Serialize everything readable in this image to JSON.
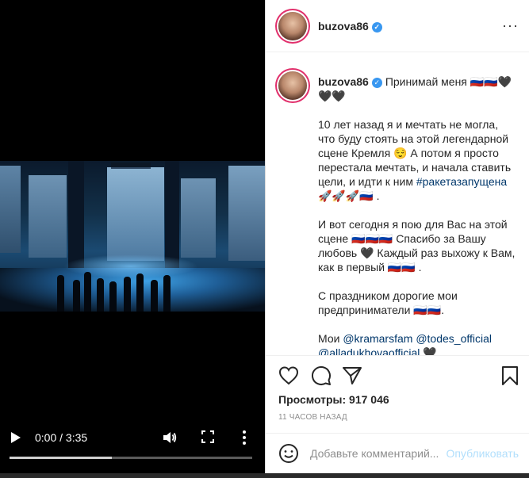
{
  "video": {
    "time": "0:00 / 3:35",
    "progress_fraction": 0.42,
    "icons": {
      "play": "play-icon",
      "volume": "volume-icon",
      "fullscreen": "fullscreen-icon",
      "more": "more-vertical-icon"
    }
  },
  "header": {
    "username": "buzova86",
    "more_label": "···"
  },
  "caption": {
    "username": "buzova86",
    "line1": "Принимай меня 🇷🇺🇷🇺🖤🖤🖤",
    "para1_a": "10 лет назад я и мечтать не могла, что буду стоять на этой легендарной сцене Кремля 😌 А потом я просто перестала мечтать, и начала ставить цели, и идти к ним ",
    "para1_tag": "#ракетазапущена",
    "para1_b": " 🚀🚀🚀🇷🇺 .",
    "para2": "И вот сегодня я пою для Вас на этой сцене 🇷🇺🇷🇺🇷🇺 Спасибо за Вашу любовь 🖤 Каждый раз выхожу к Вам, как в первый 🇷🇺🇷🇺 .",
    "para3": "С праздником дорогие мои предприниматели 🇷🇺🇷🇺.",
    "para4_prefix": "Мои ",
    "mention1": "@kramarsfam",
    "mention2": "@todes_official",
    "mention3": "@alladukhovaofficial",
    "para4_suffix": " 🖤"
  },
  "actions": {
    "views": "Просмотры: 917 046",
    "time_ago": "11 ЧАСОВ НАЗАД"
  },
  "comment": {
    "placeholder": "Добавьте комментарий...",
    "publish": "Опубликовать"
  },
  "colors": {
    "link": "#00376b",
    "verified": "#3897f0",
    "publish_disabled": "#b2dffc",
    "story_ring": "#e1306c"
  }
}
